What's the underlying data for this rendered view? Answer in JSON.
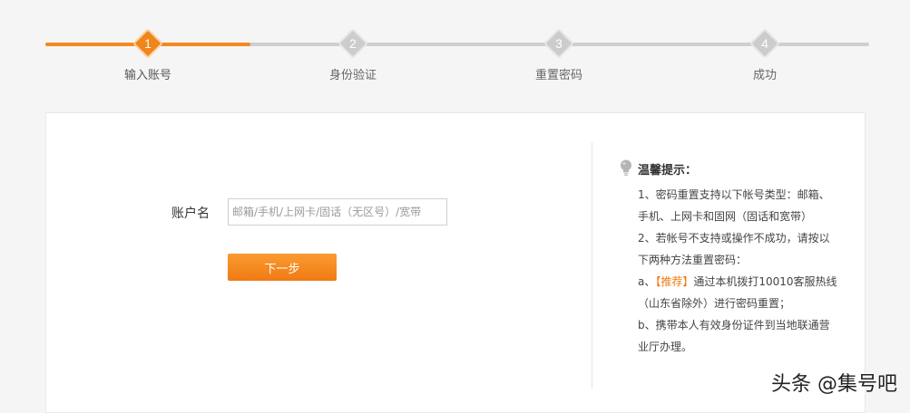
{
  "steps": [
    {
      "number": "1",
      "label": "输入账号",
      "active": true
    },
    {
      "number": "2",
      "label": "身份验证",
      "active": false
    },
    {
      "number": "3",
      "label": "重置密码",
      "active": false
    },
    {
      "number": "4",
      "label": "成功",
      "active": false
    }
  ],
  "form": {
    "account_label": "账户名",
    "account_value": "",
    "account_placeholder": "邮箱/手机/上网卡/固话（无区号）/宽带",
    "next_button_label": "下一步"
  },
  "tips": {
    "icon": "lightbulb-icon",
    "title": "温馨提示：",
    "line1": "1、密码重置支持以下帐号类型：邮箱、手机、上网卡和固网（固话和宽带）",
    "line2": "2、若帐号不支持或操作不成功，请按以下两种方法重置密码：",
    "line3_prefix": "a、",
    "line3_recommend": "【推荐】",
    "line3_rest": "通过本机拨打10010客服热线（山东省除外）进行密码重置；",
    "line4": "b、携带本人有效身份证件到当地联通营业厅办理。"
  },
  "watermark": "头条 @集号吧",
  "colors": {
    "accent": "#f08519",
    "inactive_step": "#cccccc",
    "page_background": "#f5f5f5"
  }
}
